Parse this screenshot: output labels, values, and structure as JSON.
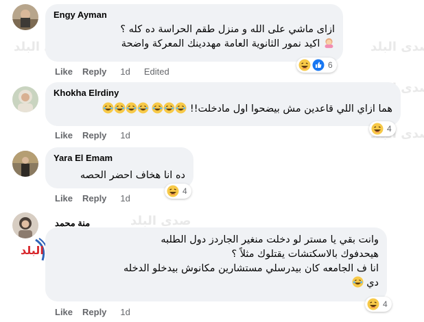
{
  "watermark": "صدى البلد",
  "logo_text": "البلد",
  "comments": [
    {
      "author": "Engy Ayman",
      "lines": [
        "ازاى ماشي على الله و منزل طقم الحراسة ده كله ؟",
        "اكيد نمور الثانوية العامة مهددينك المعركة واضحة"
      ],
      "reactions": {
        "count": "6",
        "icons": [
          "haha-icon",
          "like-icon"
        ]
      },
      "actions": {
        "like": "Like",
        "reply": "Reply",
        "time": "1d",
        "edited": "Edited"
      }
    },
    {
      "author": "Khokha Elrdiny",
      "lines": [
        "هما ازاي اللي قاعدين مش بيضحوا اول مادخلت!!"
      ],
      "reactions": {
        "count": "4",
        "icons": [
          "haha-icon"
        ]
      },
      "actions": {
        "like": "Like",
        "reply": "Reply",
        "time": "1d"
      }
    },
    {
      "author": "Yara El Emam",
      "lines": [
        "ده انا هخاف احضر الحصه"
      ],
      "reactions": {
        "count": "4",
        "icons": [
          "haha-icon"
        ]
      },
      "actions": {
        "like": "Like",
        "reply": "Reply",
        "time": "1d"
      }
    },
    {
      "author": "منة محمد",
      "lines": [
        "وانت بقي يا مستر لو دخلت منغير الجاردز دول الطلبه",
        "هيحدفوك بالاسكتشات يقتلوك مثلاً ؟",
        "انا ف الجامعه كان بيدرسلي مستشارين مكانوش بيدخلو الدخله",
        "دي"
      ],
      "reactions": {
        "count": "4",
        "icons": [
          "haha-icon"
        ]
      },
      "actions": {
        "like": "Like",
        "reply": "Reply",
        "time": "1d"
      }
    }
  ]
}
